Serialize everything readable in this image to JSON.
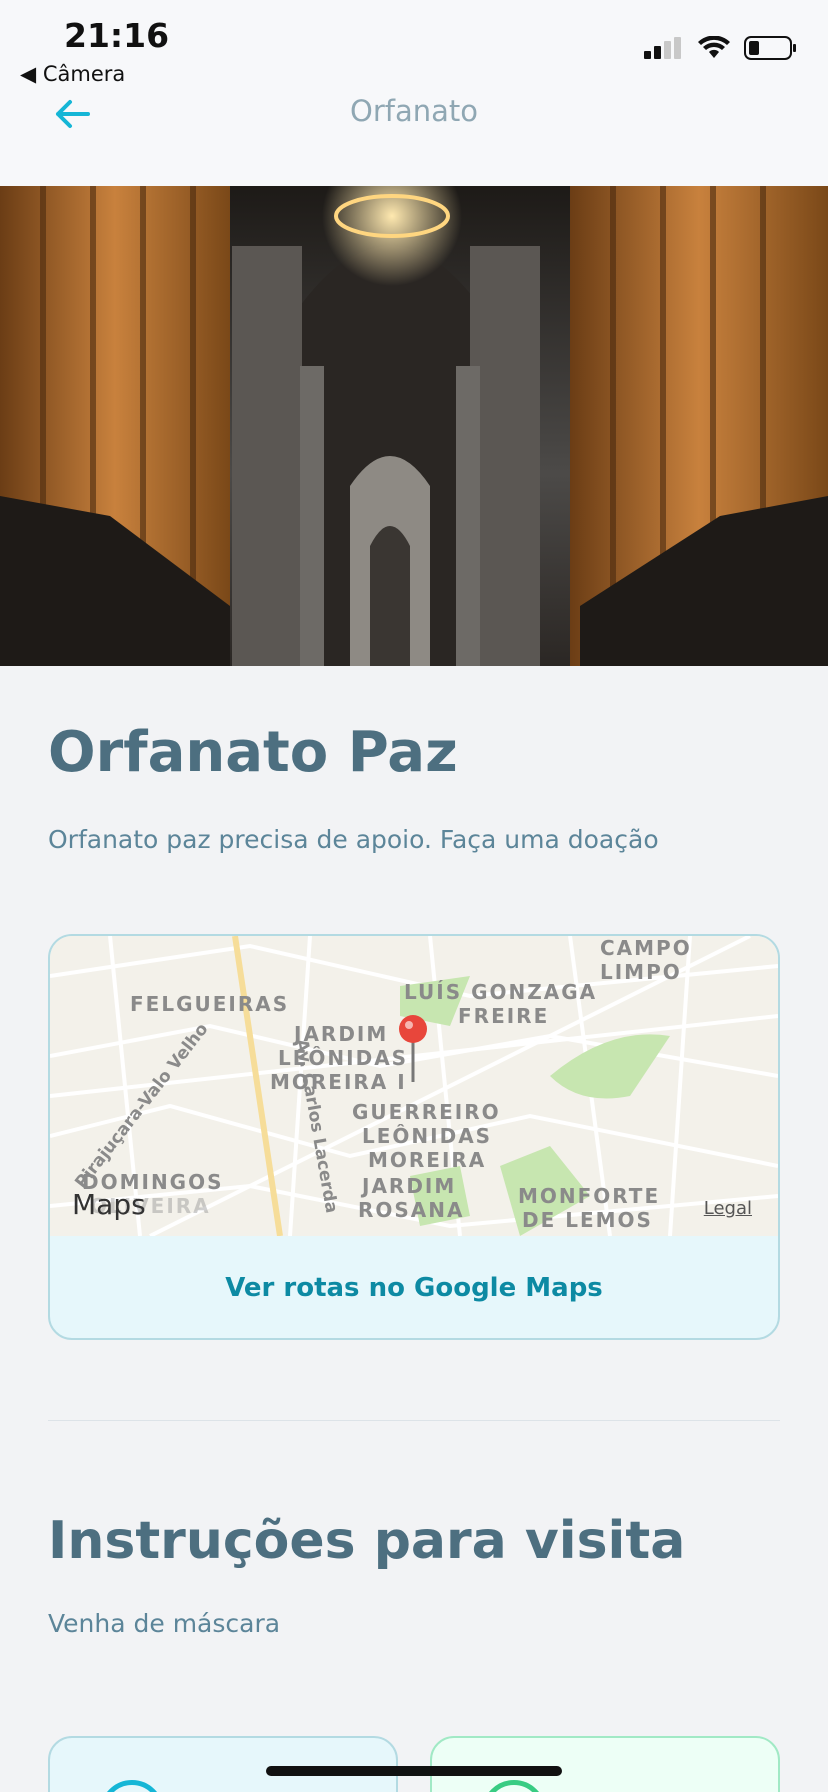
{
  "status": {
    "time": "21:16",
    "back_app": "◀ Câmera"
  },
  "header": {
    "title": "Orfanato"
  },
  "orphanage": {
    "name": "Orfanato Paz",
    "about": "Orfanato paz precisa de apoio. Faça uma doação"
  },
  "map": {
    "labels": [
      "CAMPO LIMPO",
      "LUÍS GONZAGA",
      "FREIRE",
      "FELGUEIRAS",
      "JARDIM",
      "LEÔNIDAS",
      "MOREIRA I",
      "GUERREIRO",
      "LEÔNIDAS",
      "MOREIRA",
      "JARDIM",
      "ROSANA",
      "MONFORTE",
      "DE LEMOS",
      "DOMINGOS",
      "OLIVEIRA",
      "Av. Carlos Lacerda",
      "Pirajuçara-Valo Velho"
    ],
    "provider": "Maps",
    "legal": "Legal",
    "link_label": "Ver rotas no Google Maps"
  },
  "visit": {
    "title": "Instruções para visita",
    "instructions": "Venha de máscara"
  },
  "colors": {
    "primary_text": "#4d6f80",
    "accent_blue": "#15b6d6",
    "accent_green": "#39cc83",
    "map_pin": "#e8463b"
  }
}
